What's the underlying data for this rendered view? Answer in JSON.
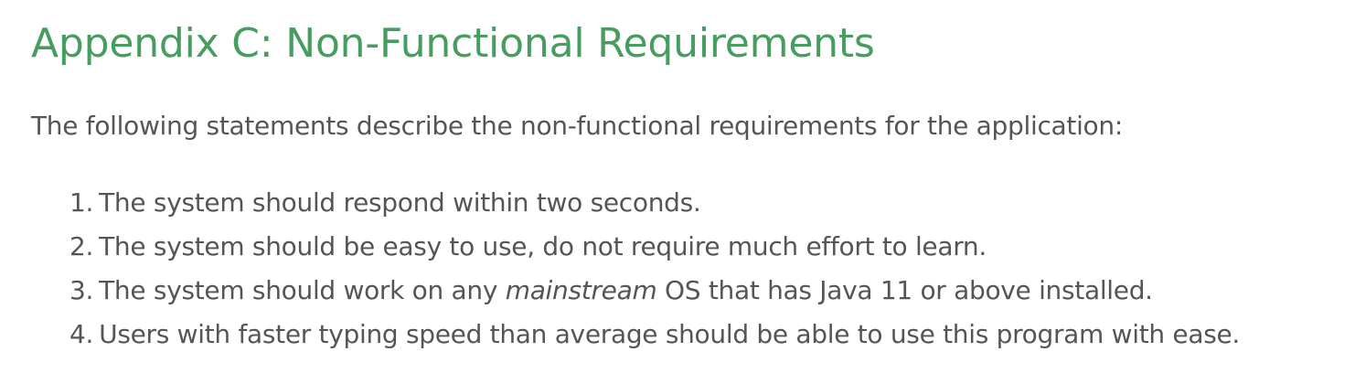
{
  "heading": "Appendix C: Non-Functional Requirements",
  "intro": "The following statements describe the non-functional requirements for the application:",
  "requirements": [
    {
      "number": "1.",
      "text": "The system should respond within two seconds."
    },
    {
      "number": "2.",
      "text": "The system should be easy to use, do not require much effort to learn."
    },
    {
      "number": "3.",
      "before": "The system should work on any ",
      "emphasis": "mainstream",
      "after": " OS that has Java 11 or above installed."
    },
    {
      "number": "4.",
      "text": "Users with faster typing speed than average should be able to use this program with ease."
    }
  ],
  "colors": {
    "heading": "#479c5f",
    "body_text": "#555555",
    "background": "#ffffff"
  }
}
